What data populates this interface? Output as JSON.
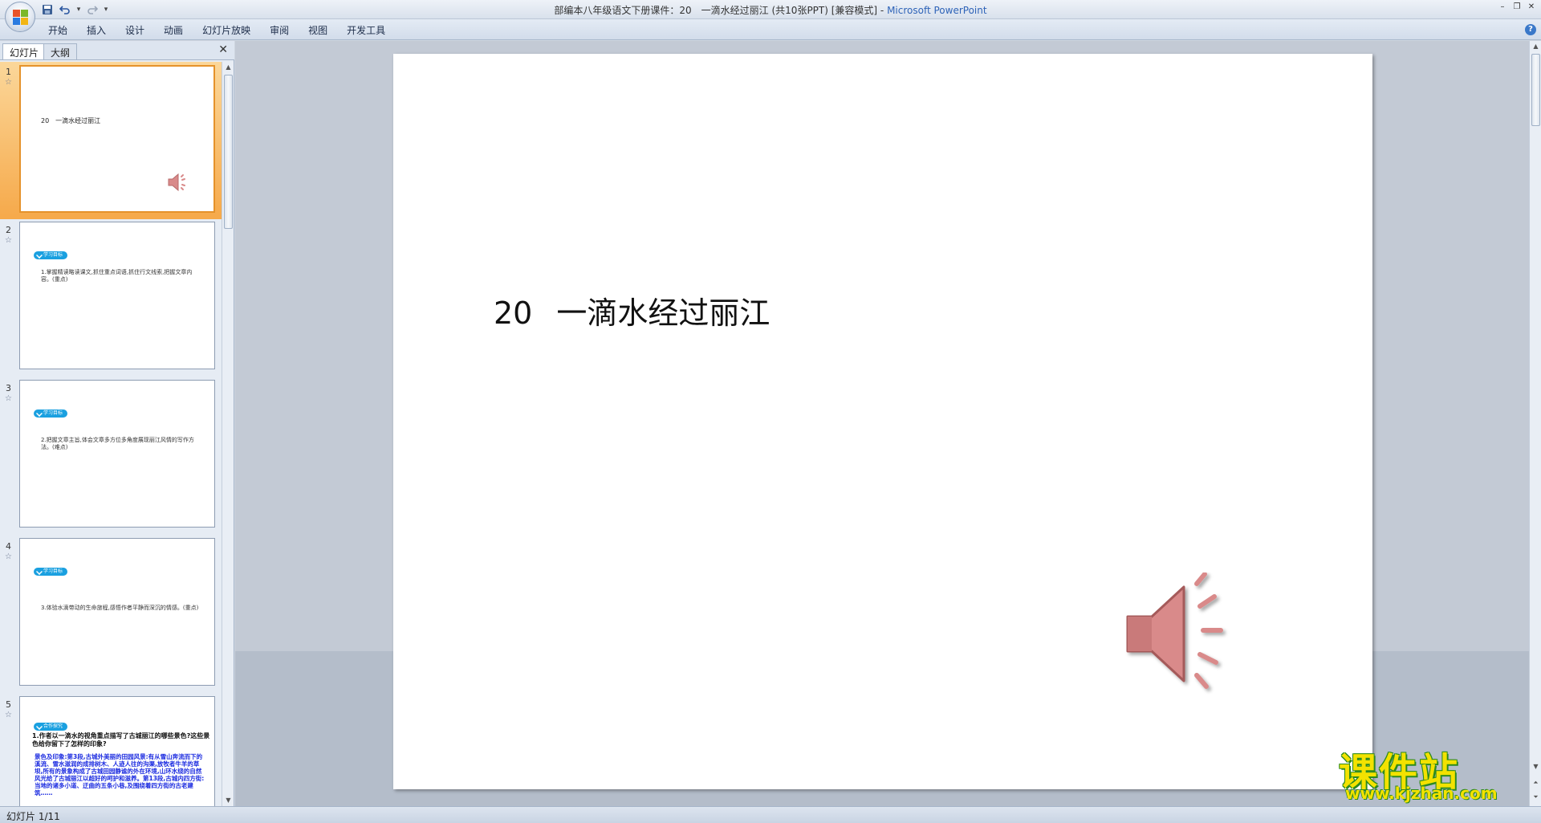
{
  "window": {
    "title": "部编本八年级语文下册课件：20　一滴水经过丽江 (共10张PPT) [兼容模式] - ",
    "app_name": "Microsoft PowerPoint"
  },
  "quick_access": {
    "save": "save-icon",
    "undo": "undo-icon",
    "redo": "redo-icon",
    "dropdown": "▾"
  },
  "ribbon": {
    "tabs": [
      {
        "label": "开始"
      },
      {
        "label": "插入"
      },
      {
        "label": "设计"
      },
      {
        "label": "动画"
      },
      {
        "label": "幻灯片放映"
      },
      {
        "label": "审阅"
      },
      {
        "label": "视图"
      },
      {
        "label": "开发工具"
      }
    ],
    "help": "?"
  },
  "left_pane": {
    "tabs": {
      "slides": "幻灯片",
      "outline": "大纲"
    },
    "close": "✕",
    "thumbnails": [
      {
        "number": "1",
        "title": "20　一滴水经过丽江",
        "selected": true
      },
      {
        "number": "2",
        "badge": "学习目标",
        "text": "1.掌握精读略读课文,抓住重点词语,抓住行文线索,把握文章内容。(重点)"
      },
      {
        "number": "3",
        "badge": "学习目标",
        "text": "2.把握文章主旨,体会文章多方位多角度展现丽江风情的写作方法。(难点)"
      },
      {
        "number": "4",
        "badge": "学习目标",
        "text": "3.体验水滴带动的生命旅程,感悟作者平静而深沉的情感。(重点)"
      },
      {
        "number": "5",
        "badge": "合作探究",
        "question": "1.作者以一滴水的视角重点描写了古城丽江的哪些景色?这些景色给你留下了怎样的印象?",
        "answer": "景色及印象:第3段,古城外美丽的田园风景:有从雪山奔流而下的溪流、雪水滋润的成排树木、人迹人往的沟渠,放牧者牛羊的草坝,所有的景象构成了古城田园静谧的外在环境,山环水绕的自然风光给了古城丽江以超好的呵护和滋养。第13段,古城内四方街:当地的诸多小道、迂曲的五条小巷,及围绕着四方街的古老建筑……"
      }
    ]
  },
  "slide": {
    "title_number": "20",
    "title_text": "一滴水经过丽江"
  },
  "status": {
    "text": "幻灯片 1/11"
  },
  "watermark": {
    "title": "课件站",
    "url": "www.kjzhan.com"
  },
  "colors": {
    "accent_orange": "#f6a94a",
    "badge_blue": "#1aa0e0",
    "speaker": "#d98a8a",
    "watermark": "#f3e200"
  }
}
